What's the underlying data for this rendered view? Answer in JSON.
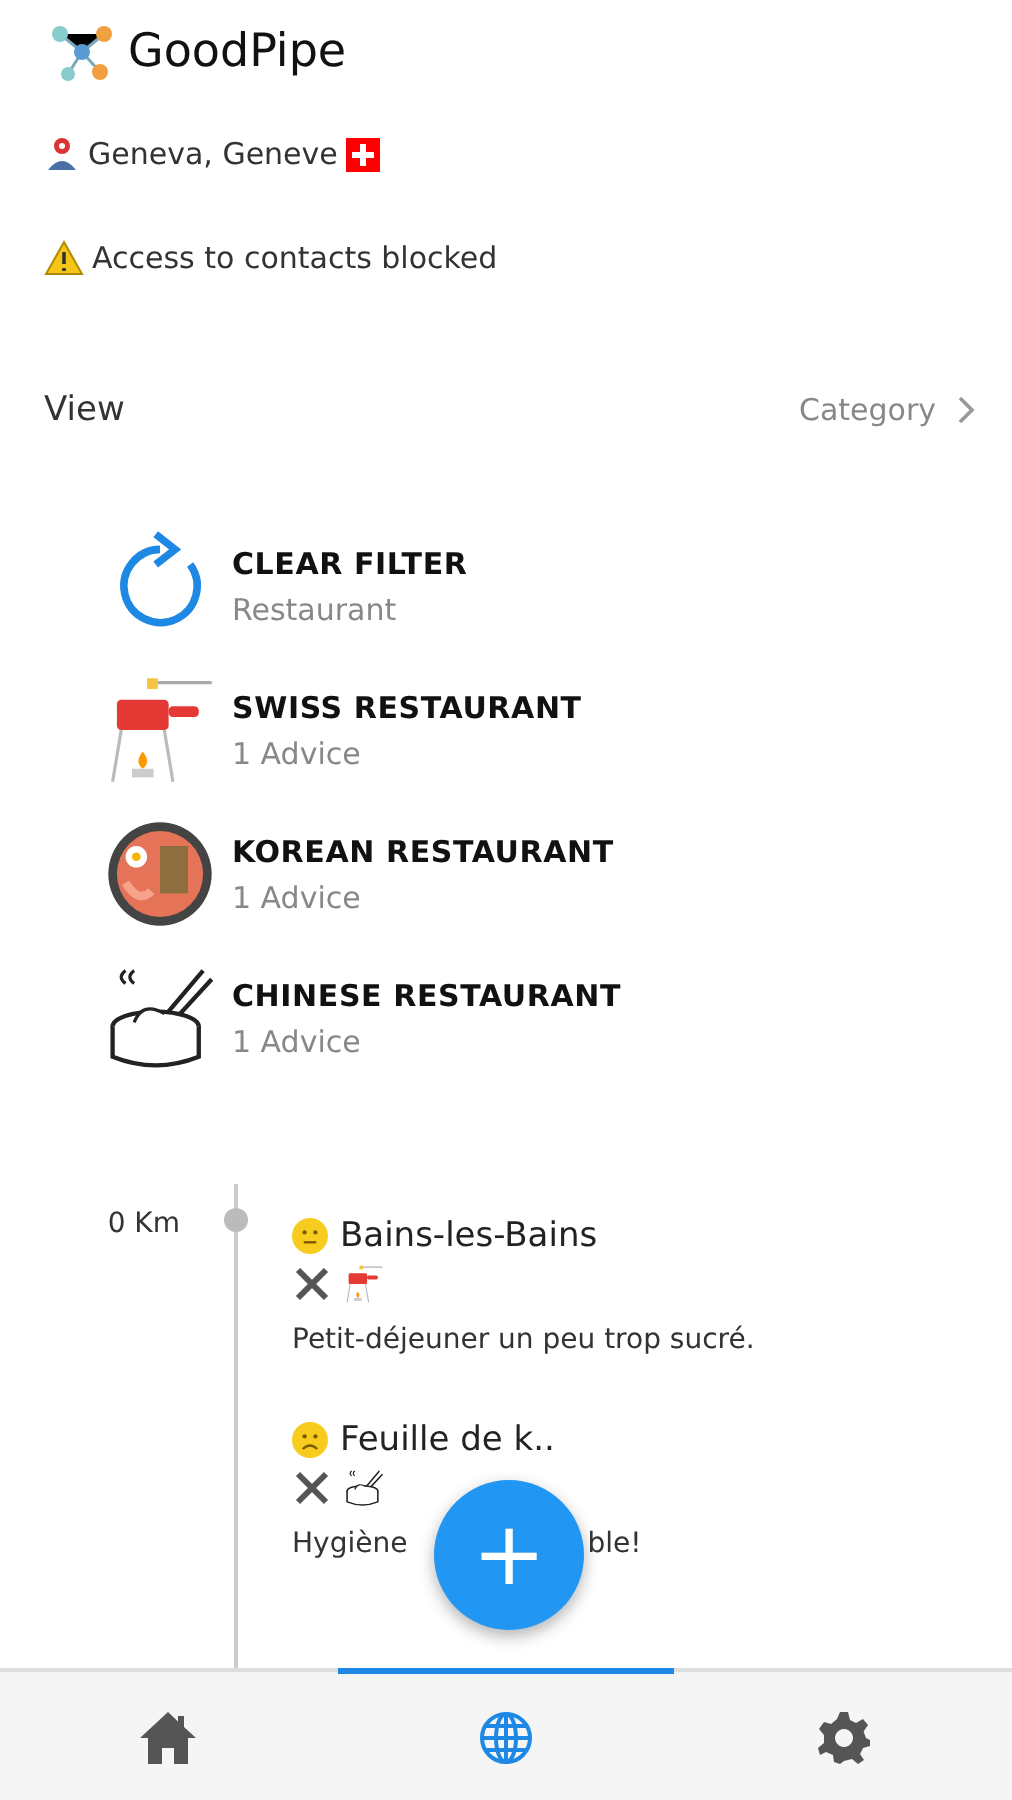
{
  "app": {
    "title": "GoodPipe"
  },
  "location": {
    "text": "Geneva, Geneve"
  },
  "warning": {
    "text": "Access to contacts blocked"
  },
  "view": {
    "label": "View",
    "value": "Category"
  },
  "categories": [
    {
      "kind": "clear",
      "title": "CLEAR FILTER",
      "subtitle": "Restaurant"
    },
    {
      "kind": "swiss",
      "title": "SWISS RESTAURANT",
      "subtitle": "1 Advice"
    },
    {
      "kind": "korean",
      "title": "KOREAN RESTAURANT",
      "subtitle": "1 Advice"
    },
    {
      "kind": "chinese",
      "title": "CHINESE RESTAURANT",
      "subtitle": "1 Advice"
    }
  ],
  "timeline": {
    "distance": "0 Km",
    "entries": [
      {
        "kind": "neutral",
        "tags": [
          {
            "kind": "cutlery"
          },
          {
            "kind": "swiss"
          }
        ],
        "name": "Bains-les-Bains",
        "comment": [
          "Petit-déjeuner un peu trop sucré."
        ]
      },
      {
        "kind": "sad",
        "tags": [
          {
            "kind": "cutlery"
          },
          {
            "kind": "chinese"
          }
        ],
        "name": "Feuille de k..",
        "comment": [
          "Hygiène",
          "ble!"
        ]
      }
    ]
  },
  "fab": {
    "label": "+"
  },
  "nav": [
    {
      "kind": "home",
      "selected": false
    },
    {
      "kind": "globe",
      "selected": true
    },
    {
      "kind": "settings",
      "selected": false
    }
  ]
}
